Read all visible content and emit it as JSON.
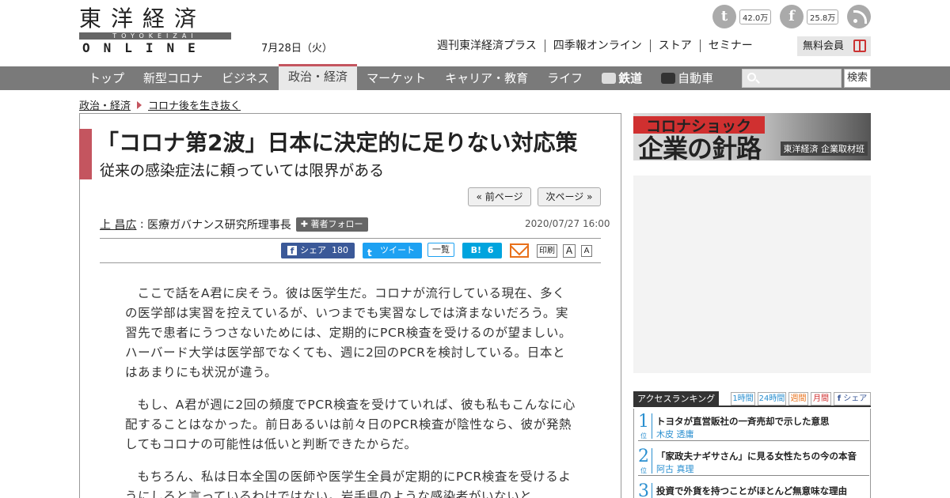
{
  "header": {
    "logo_kanji": "東洋経済",
    "logo_romaji": "TOYOKEIZAI",
    "logo_online": "ONLINE",
    "date": "7月28日（火）",
    "links": [
      "週刊東洋経済プラス",
      "四季報オンライン",
      "ストア",
      "セミナー"
    ],
    "member_button": "無料会員",
    "twitter_count": "42.0万",
    "facebook_count": "25.8万"
  },
  "nav": {
    "items": [
      "トップ",
      "新型コロナ",
      "ビジネス",
      "政治・経済",
      "マーケット",
      "キャリア・教育",
      "ライフ",
      "鉄道",
      "自動車"
    ],
    "active_index": 3,
    "search_button": "検索"
  },
  "breadcrumb": [
    "政治・経済",
    "コロナ後を生き抜く"
  ],
  "article": {
    "title": "「コロナ第2波」日本に決定的に足りない対応策",
    "subtitle": "従来の感染症法に頼っていては限界がある",
    "prev_label": "« 前ページ",
    "next_label": "次ページ »",
    "author_name": "上 昌広",
    "author_role": "医療ガバナンス研究所理事長",
    "follow_label": "著者フォロー",
    "published": "2020/07/27 16:00",
    "share": {
      "facebook_label": "シェア",
      "facebook_count": "180",
      "tweet_label": "ツイート",
      "list_label": "一覧",
      "hatena_label": "B!",
      "hatena_count": "6",
      "print_label": "印刷",
      "font_large": "A",
      "font_small": "A"
    },
    "paragraphs": [
      "ここで話をA君に戻そう。彼は医学生だ。コロナが流行している現在、多くの医学部は実習を控えているが、いつまでも実習なしでは済まないだろう。実習先で患者にうつさないためには、定期的にPCR検査を受けるのが望ましい。ハーバード大学は医学部でなくても、週に2回のPCRを検討している。日本とはあまりにも状況が違う。",
      "もし、A君が週に2回の頻度でPCR検査を受けていれば、彼も私もこんなに心配することはなかった。前日あるいは前々日のPCR検査が陰性なら、彼が発熱してもコロナの可能性は低いと判断できたからだ。",
      "もちろん、私は日本全国の医師や医学生全員が定期的にPCR検査を受けるようにしろと言っているわけではない。岩手県のような感染者がいないと"
    ]
  },
  "sidebar": {
    "banner_title": "コロナショック",
    "banner_main": "企業の針路",
    "banner_caption": "東洋経済 企業取材班",
    "ranking_label": "アクセスランキング",
    "ranking_tabs": [
      "1時間",
      "24時間",
      "週間",
      "月間",
      "シェア"
    ],
    "ranking": [
      {
        "rank": "1",
        "suffix": "位",
        "title": "トヨタが直営販社の一斉売却で示した意思",
        "author": "木皮 透庸"
      },
      {
        "rank": "2",
        "suffix": "位",
        "title": "「家政夫ナギサさん」に見る女性たちの今の本音",
        "author": "阿古 真理"
      },
      {
        "rank": "3",
        "suffix": "位",
        "title": "投資で外貨を持つことがほとんど無意味な理由",
        "author": ""
      }
    ]
  }
}
